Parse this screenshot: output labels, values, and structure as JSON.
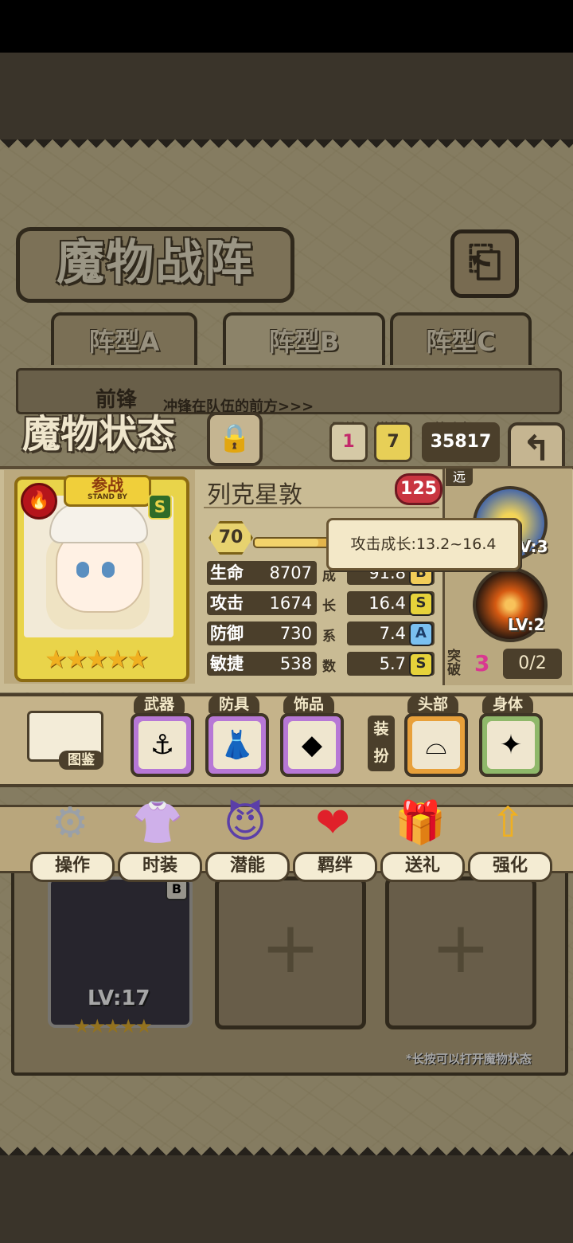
{
  "screen_title": "魔物战阵",
  "formation_tabs": [
    {
      "label": "阵型A",
      "active": false
    },
    {
      "label": "阵型B",
      "active": true
    },
    {
      "label": "阵型C",
      "active": false
    }
  ],
  "front_row": {
    "label": "前锋",
    "description": "冲锋在队伍的前方>>>"
  },
  "lower_slot": {
    "level": "LV:17",
    "grade": "B"
  },
  "hint_text": "*长按可以打开魔物状态",
  "status": {
    "title": "魔物状态",
    "bond_label": "羁绊",
    "bond_value": "1",
    "potential_label": "潜能",
    "potential_value": "7",
    "power_label": "战斗力",
    "power_value": "35817"
  },
  "character": {
    "name": "列克星敦",
    "heart_level": "125",
    "standby_cn": "参战",
    "standby_en": "STAND BY",
    "rank": "S",
    "level": "70",
    "xp_fraction": 0.35,
    "stars": "★★★★★",
    "stats": [
      {
        "name": "生命",
        "value": "8707",
        "growth": "91.8",
        "grade": "B"
      },
      {
        "name": "攻击",
        "value": "1674",
        "growth": "16.4",
        "grade": "S"
      },
      {
        "name": "防御",
        "value": "730",
        "growth": "7.4",
        "grade": "A"
      },
      {
        "name": "敏捷",
        "value": "538",
        "growth": "5.7",
        "grade": "S"
      }
    ],
    "growth_label": [
      "成",
      "长",
      "系",
      "数"
    ],
    "tooltip": "攻击成长:13.2~16.4"
  },
  "skills": {
    "range": "远",
    "skill1_level": "LV:3",
    "skill2_level": "LV:2",
    "break_label": "突破",
    "break_value": "3",
    "break_progress": "0/2"
  },
  "equipment": {
    "book_label": "图鉴",
    "weapon": "武器",
    "armor": "防具",
    "accessory": "饰品",
    "dress_label": "装扮",
    "head": "头部",
    "body": "身体"
  },
  "actions": [
    {
      "label": "操作",
      "icon": "gear-icon"
    },
    {
      "label": "时装",
      "icon": "outfit-icon"
    },
    {
      "label": "潜能",
      "icon": "demon-icon"
    },
    {
      "label": "羁绊",
      "icon": "hearts-icon"
    },
    {
      "label": "送礼",
      "icon": "gift-icon"
    },
    {
      "label": "强化",
      "icon": "upgrade-arrows-icon"
    }
  ]
}
